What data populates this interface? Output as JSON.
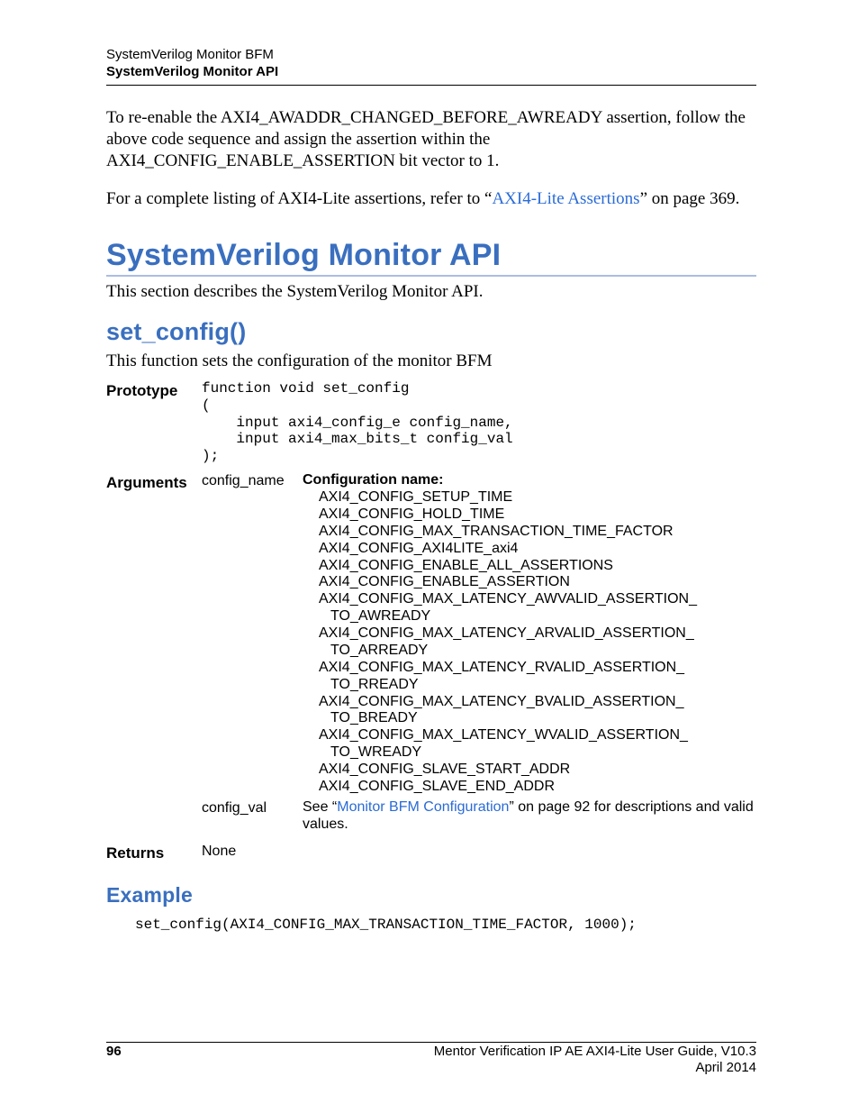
{
  "header": {
    "line1": "SystemVerilog Monitor BFM",
    "line2": "SystemVerilog Monitor API"
  },
  "intro": {
    "para1": "To re-enable the AXI4_AWADDR_CHANGED_BEFORE_AWREADY assertion, follow the above code sequence and assign the assertion within the AXI4_CONFIG_ENABLE_ASSERTION bit vector to 1.",
    "para2_pre": "For a complete listing of AXI4-Lite assertions, refer to “",
    "para2_link": "AXI4-Lite Assertions",
    "para2_post": "” on page 369."
  },
  "section": {
    "title": "SystemVerilog Monitor API",
    "desc": "This section describes the SystemVerilog Monitor API."
  },
  "func": {
    "title": "set_config()",
    "desc": "This function sets the configuration of the monitor BFM",
    "proto_label": "Prototype",
    "proto_code": "function void set_config\n(\n    input axi4_config_e config_name,\n    input axi4_max_bits_t config_val\n);",
    "args_label": "Arguments",
    "args": {
      "config_name": {
        "name": "config_name",
        "title": "Configuration name:",
        "items": [
          "AXI4_CONFIG_SETUP_TIME",
          "AXI4_CONFIG_HOLD_TIME",
          "AXI4_CONFIG_MAX_TRANSACTION_TIME_FACTOR",
          "AXI4_CONFIG_AXI4LITE_axi4",
          "AXI4_CONFIG_ENABLE_ALL_ASSERTIONS",
          "AXI4_CONFIG_ENABLE_ASSERTION",
          "AXI4_CONFIG_MAX_LATENCY_AWVALID_ASSERTION_",
          "   TO_AWREADY",
          "AXI4_CONFIG_MAX_LATENCY_ARVALID_ASSERTION_",
          "   TO_ARREADY",
          "AXI4_CONFIG_MAX_LATENCY_RVALID_ASSERTION_",
          "   TO_RREADY",
          "AXI4_CONFIG_MAX_LATENCY_BVALID_ASSERTION_",
          "   TO_BREADY",
          "AXI4_CONFIG_MAX_LATENCY_WVALID_ASSERTION_",
          "   TO_WREADY",
          "AXI4_CONFIG_SLAVE_START_ADDR",
          "AXI4_CONFIG_SLAVE_END_ADDR"
        ]
      },
      "config_val": {
        "name": "config_val",
        "desc_pre": "See “",
        "desc_link": "Monitor BFM Configuration",
        "desc_post": "” on page 92 for descriptions and valid values."
      }
    },
    "returns_label": "Returns",
    "returns_value": "None"
  },
  "example": {
    "title": "Example",
    "code": "set_config(AXI4_CONFIG_MAX_TRANSACTION_TIME_FACTOR, 1000);"
  },
  "footer": {
    "page": "96",
    "right1": "Mentor Verification IP AE AXI4-Lite User Guide, V10.3",
    "right2": "April 2014"
  }
}
